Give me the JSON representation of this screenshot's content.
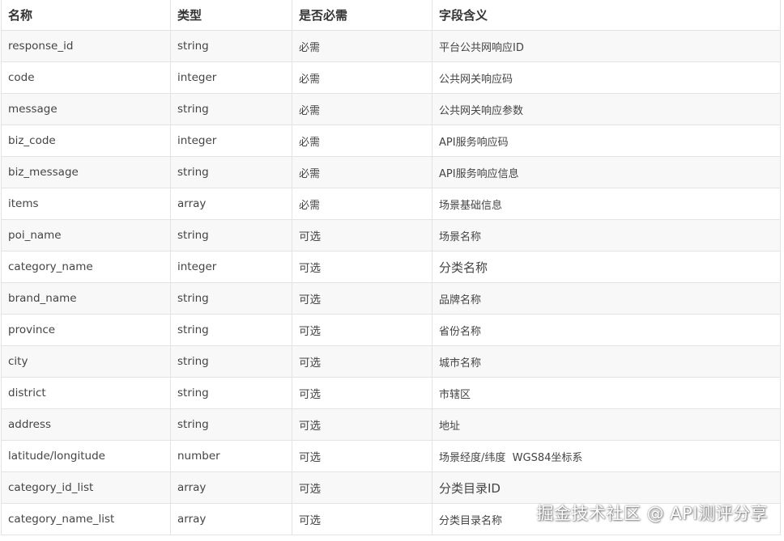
{
  "header": {
    "name": "名称",
    "type": "类型",
    "required": "是否必需",
    "meaning": "字段含义"
  },
  "rows": [
    {
      "name": "response_id",
      "type": "string",
      "required": "必需",
      "meaning": "平台公共网响应ID"
    },
    {
      "name": "code",
      "type": "integer",
      "required": "必需",
      "meaning": "公共网关响应码"
    },
    {
      "name": "message",
      "type": "string",
      "required": "必需",
      "meaning": "公共网关响应参数"
    },
    {
      "name": "biz_code",
      "type": "integer",
      "required": "必需",
      "meaning": "API服务响应码"
    },
    {
      "name": "biz_message",
      "type": "string",
      "required": "必需",
      "meaning": "API服务响应信息"
    },
    {
      "name": "items",
      "type": "array",
      "required": "必需",
      "meaning": "场景基础信息"
    },
    {
      "name": "poi_name",
      "type": "string",
      "required": "可选",
      "meaning": "场景名称"
    },
    {
      "name": "category_name",
      "type": "integer",
      "required": "可选",
      "meaning": "分类名称"
    },
    {
      "name": "brand_name",
      "type": "string",
      "required": "可选",
      "meaning": "品牌名称"
    },
    {
      "name": "province",
      "type": "string",
      "required": "可选",
      "meaning": "省份名称"
    },
    {
      "name": "city",
      "type": "string",
      "required": "可选",
      "meaning": "城市名称"
    },
    {
      "name": "district",
      "type": "string",
      "required": "可选",
      "meaning": "市辖区"
    },
    {
      "name": "address",
      "type": "string",
      "required": "可选",
      "meaning": "地址"
    },
    {
      "name": "latitude/longitude",
      "type": "number",
      "required": "可选",
      "meaning": "场景经度/纬度  WGS84坐标系"
    },
    {
      "name": "category_id_list",
      "type": "array",
      "required": "可选",
      "meaning": "分类目录ID"
    },
    {
      "name": "category_name_list",
      "type": "array",
      "required": "可选",
      "meaning": "分类目录名称"
    }
  ],
  "watermark": "掘金技术社区 @ API测评分享"
}
